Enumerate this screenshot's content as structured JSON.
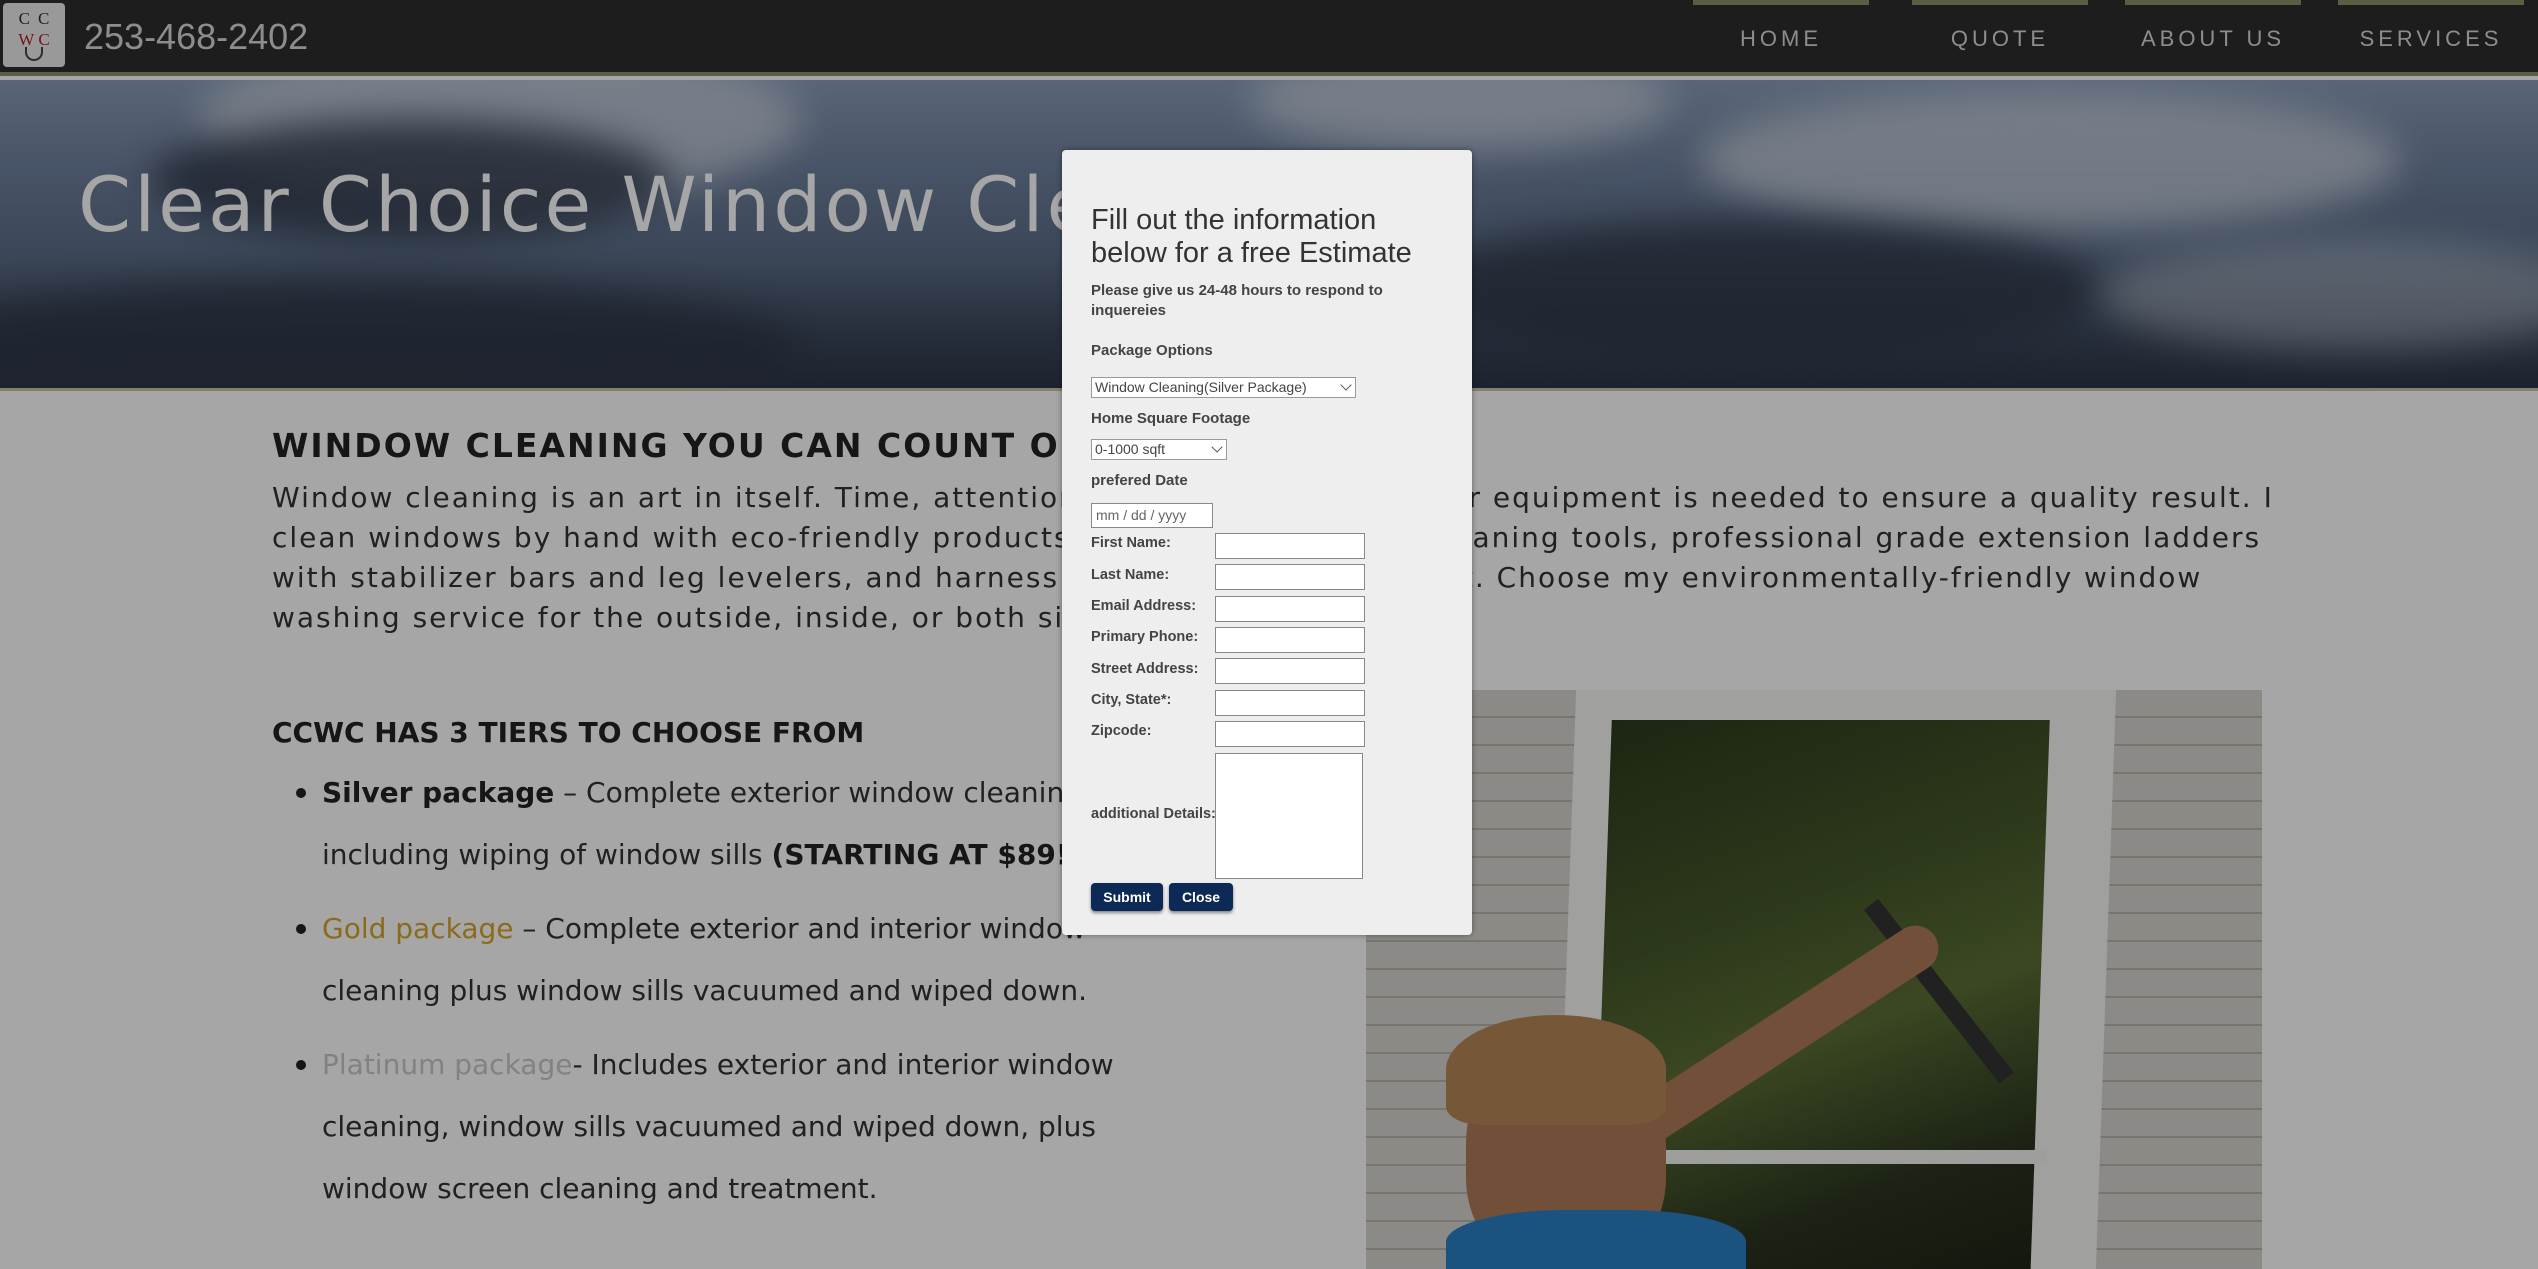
{
  "header": {
    "logo_top": "CC",
    "logo_bottom": "WC",
    "phone": "253-468-2402",
    "nav": [
      "HOME",
      "QUOTE",
      "ABOUT US",
      "SERVICES"
    ]
  },
  "hero": {
    "title": "Clear Choice Window Cleaning"
  },
  "content": {
    "heading": "WINDOW CLEANING YOU CAN COUNT ON",
    "intro": "Window cleaning is an art in itself. Time, attention to detail, and the proper equipment is needed to ensure a quality result. I clean windows by hand with eco-friendly products, professional window cleaning tools, professional grade extension ladders with stabilizer bars and leg levelers, and harness fall protection equipment. Choose my environmentally-friendly window washing service for the outside, inside, or both sides of your windows.",
    "tiers_title": "CCWC HAS 3 TIERS TO CHOOSE FROM",
    "tiers": [
      {
        "name": "Silver package",
        "desc": " – Complete exterior window cleaning, including wiping of window sills ",
        "note": "(STARTING AT $89!!!)"
      },
      {
        "name": "Gold package",
        "desc": " – Complete exterior and interior window cleaning plus window sills vacuumed and wiped down.",
        "note": ""
      },
      {
        "name": "Platinum package",
        "desc": "- Includes exterior and interior window cleaning, window sills vacuumed and wiped down, plus window screen cleaning and treatment.",
        "note": ""
      }
    ]
  },
  "modal": {
    "title": "Fill out the information below for a free Estimate",
    "subtitle": "Please give us 24-48 hours to respond to inquereies",
    "package_label": "Package Options",
    "package_value": "Window Cleaning(Silver Package)",
    "sqft_label": "Home Square Footage",
    "sqft_value": "0-1000 sqft",
    "date_label": "prefered Date",
    "date_placeholder": "mm / dd / yyyy",
    "fields": [
      "First Name:",
      "Last Name:",
      "Email Address:",
      "Primary Phone:",
      "Street Address:",
      "City, State*:",
      "Zipcode:"
    ],
    "details_label": "additional Details:",
    "submit": "Submit",
    "close": "Close"
  },
  "colors": {
    "header_bg": "#2d2d2d",
    "accent": "#8e9169",
    "gold": "#d4a52a",
    "button": "#0d2a56"
  }
}
